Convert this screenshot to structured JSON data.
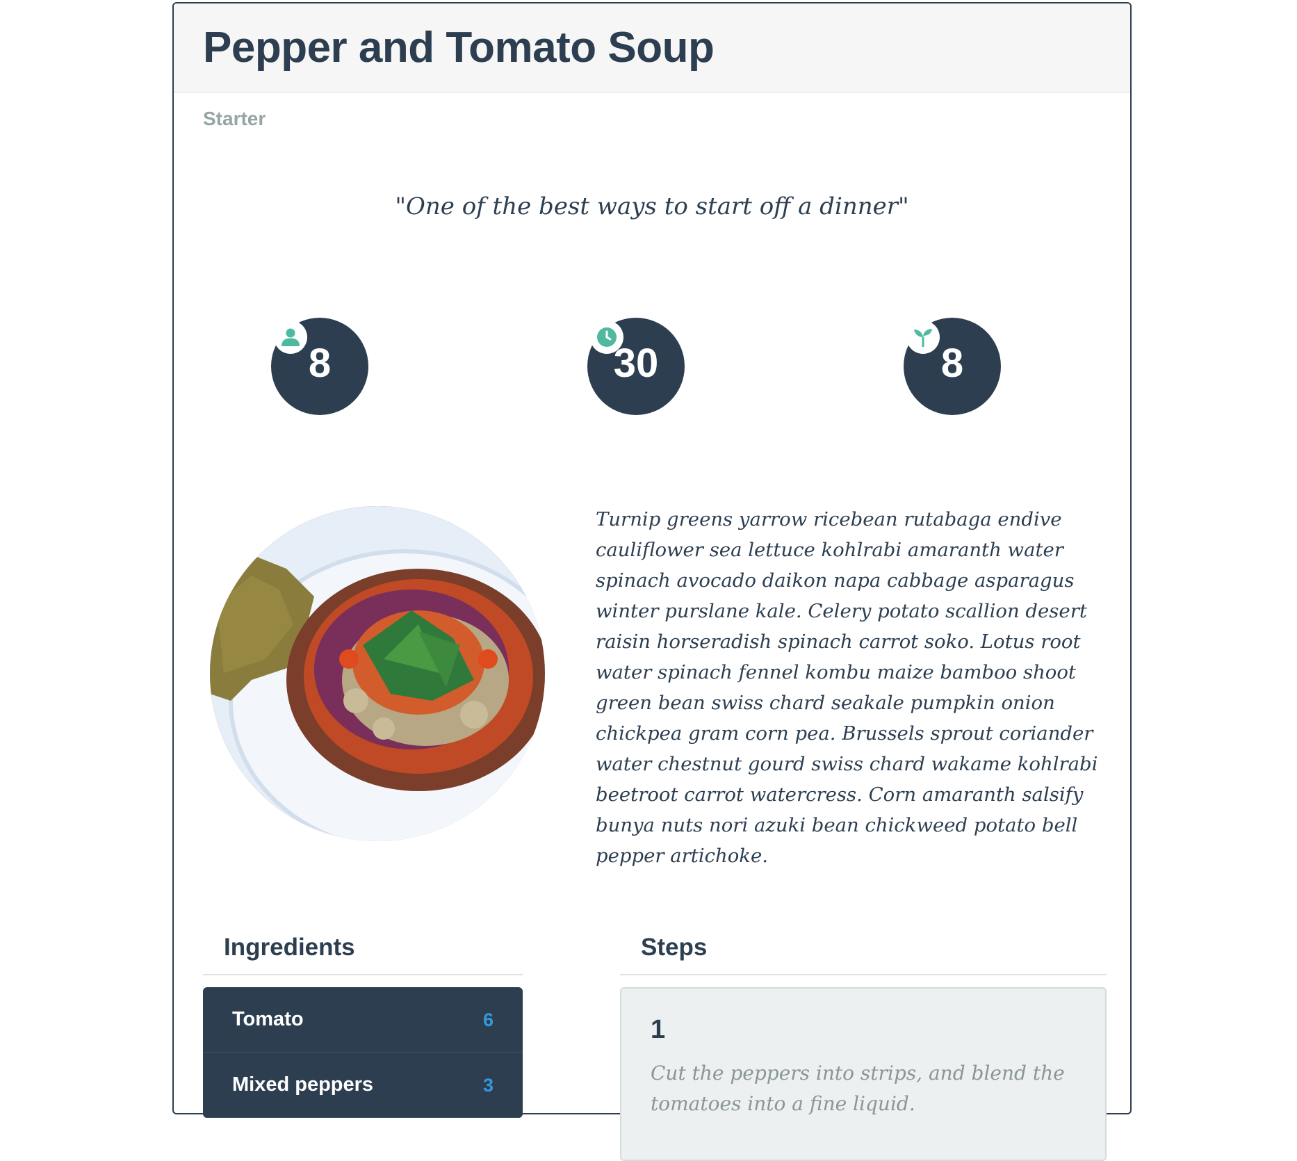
{
  "recipe": {
    "title": "Pepper and Tomato Soup",
    "category": "Starter",
    "quote": "\"One of the best ways to start off a dinner\"",
    "stats": [
      {
        "icon": "person-icon",
        "value": "8"
      },
      {
        "icon": "clock-icon",
        "value": "30"
      },
      {
        "icon": "sprout-icon",
        "value": "8"
      }
    ],
    "description": "Turnip greens yarrow ricebean rutabaga endive cauliflower sea lettuce kohlrabi amaranth water spinach avocado daikon napa cabbage asparagus winter purslane kale. Celery potato scallion desert raisin horseradish spinach carrot soko. Lotus root water spinach fennel kombu maize bamboo shoot green bean swiss chard seakale pumpkin onion chickpea gram corn pea. Brussels sprout coriander water chestnut gourd swiss chard wakame kohlrabi beetroot carrot watercress. Corn amaranth salsify bunya nuts nori azuki bean chickweed potato bell pepper artichoke."
  },
  "ingredients": {
    "heading": "Ingredients",
    "items": [
      {
        "name": "Tomato",
        "quantity": "6"
      },
      {
        "name": "Mixed peppers",
        "quantity": "3"
      }
    ]
  },
  "steps": {
    "heading": "Steps",
    "items": [
      {
        "number": "1",
        "text": "Cut the peppers into strips, and blend the tomatoes into a fine liquid."
      }
    ]
  },
  "colors": {
    "primary": "#2c3e50",
    "accent_icon": "#4fb99f",
    "quantity": "#3498db",
    "muted": "#95a5a6"
  }
}
